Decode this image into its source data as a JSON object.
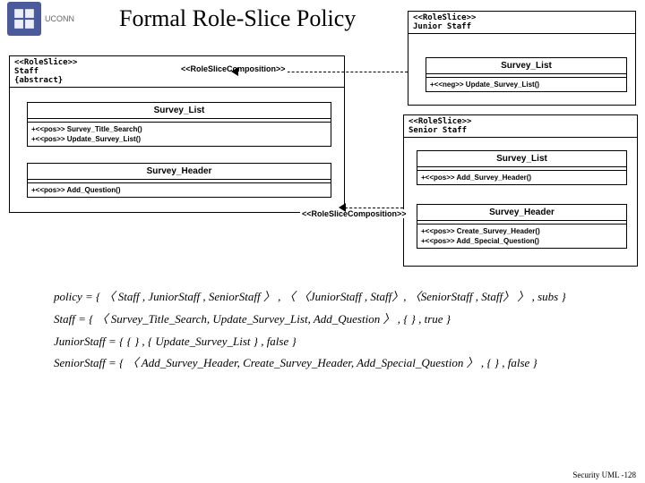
{
  "header": {
    "brand": "UCONN",
    "title": "Formal Role-Slice Policy"
  },
  "labels": {
    "composition": "<<RoleSliceComposition>>"
  },
  "roles": {
    "staff": {
      "stereotype": "<<RoleSlice>>",
      "name": "Staff",
      "modifier": "{abstract}"
    },
    "junior": {
      "stereotype": "<<RoleSlice>>",
      "name": "Junior Staff"
    },
    "senior": {
      "stereotype": "<<RoleSlice>>",
      "name": "Senior Staff"
    }
  },
  "classes": {
    "staff_survey_list": {
      "name": "Survey_List",
      "ops": [
        "+<<pos>> Survey_Title_Search()",
        "+<<pos>> Update_Survey_List()"
      ]
    },
    "staff_survey_header": {
      "name": "Survey_Header",
      "ops": [
        "+<<pos>> Add_Question()"
      ]
    },
    "junior_survey_list": {
      "name": "Survey_List",
      "ops": [
        "+<<neg>> Update_Survey_List()"
      ]
    },
    "senior_survey_list": {
      "name": "Survey_List",
      "ops": [
        "+<<pos>> Add_Survey_Header()"
      ]
    },
    "senior_survey_header": {
      "name": "Survey_Header",
      "ops": [
        "+<<pos>> Create_Survey_Header()",
        "+<<pos>> Add_Special_Question()"
      ]
    }
  },
  "formulas": {
    "policy": "policy = { 〈 Staff , JuniorStaff , SeniorStaff 〉 , 〈 〈JuniorStaff , Staff〉, 〈SeniorStaff , Staff〉 〉 , subs }",
    "staff": "Staff = { 〈 Survey_Title_Search, Update_Survey_List, Add_Question 〉 , { } , true }",
    "junior": "JuniorStaff = { { } , { Update_Survey_List } , false }",
    "senior": "SeniorStaff = { 〈 Add_Survey_Header, Create_Survey_Header, Add_Special_Question 〉 , { } , false }"
  },
  "footer": "Security UML -128"
}
